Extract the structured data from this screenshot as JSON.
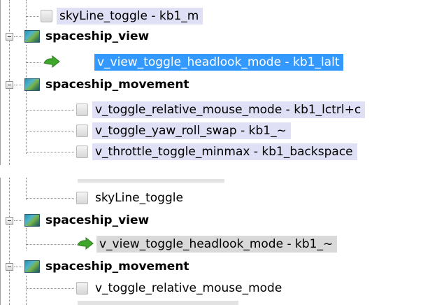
{
  "panel1": {
    "rows": [
      {
        "label": "skyLine_toggle - kb1_m"
      },
      {
        "label": "spaceship_view"
      },
      {
        "label": "v_view_toggle_headlook_mode - kb1_lalt"
      },
      {
        "label": "spaceship_movement"
      },
      {
        "label": "v_toggle_relative_mouse_mode - kb1_lctrl+c"
      },
      {
        "label": "v_toggle_yaw_roll_swap - kb1_~"
      },
      {
        "label": "v_throttle_toggle_minmax - kb1_backspace"
      }
    ]
  },
  "panel2": {
    "rows": [
      {
        "label": "skyLine_toggle"
      },
      {
        "label": "spaceship_view"
      },
      {
        "label": "v_view_toggle_headlook_mode - kb1_~"
      },
      {
        "label": "spaceship_movement"
      },
      {
        "label": "v_toggle_relative_mouse_mode"
      }
    ]
  },
  "colors": {
    "leaf_bg": "#dfe0f5",
    "selected_blue": "#3399ff",
    "selected_gray": "#d9d9d9"
  }
}
